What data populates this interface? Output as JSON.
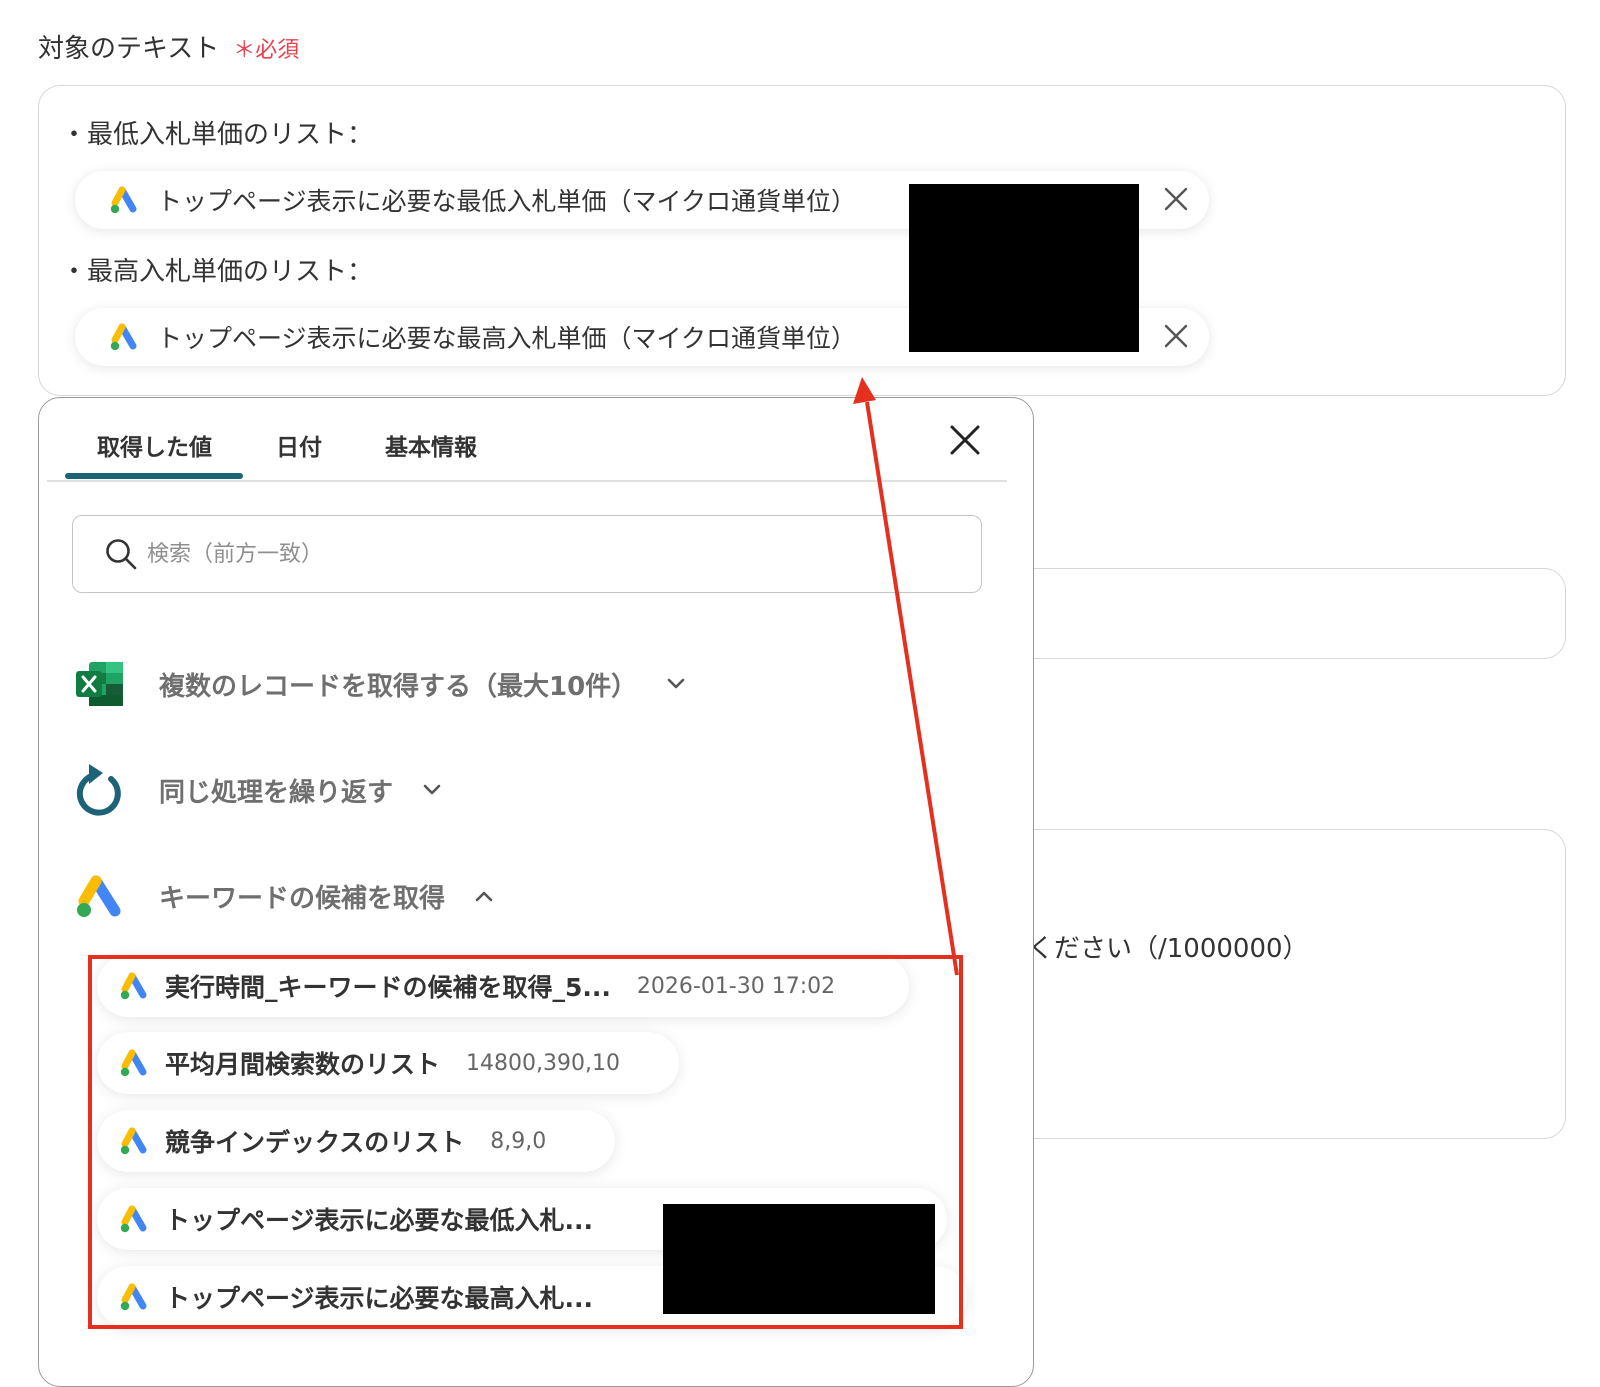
{
  "field": {
    "label": "対象のテキスト",
    "required_mark": "＊",
    "required_text": "必須"
  },
  "text_box": {
    "line1": "・最低入札単価のリスト：",
    "chip1": "トップページ表示に必要な最低入札単価（マイクロ通貨単位）",
    "line2": "・最高入札単価のリスト：",
    "chip2": "トップページ表示に必要な最高入札単価（マイクロ通貨単位）"
  },
  "background": {
    "partial_text": "ください（/1000000）"
  },
  "panel": {
    "tabs": [
      "取得した値",
      "日付",
      "基本情報"
    ],
    "active_tab": 0,
    "search_placeholder": "検索（前方一致）",
    "groups": [
      {
        "label": "複数のレコードを取得する（最大10件）",
        "icon": "excel-icon",
        "expanded": false
      },
      {
        "label": "同じ処理を繰り返す",
        "icon": "loop-icon",
        "expanded": false
      },
      {
        "label": "キーワードの候補を取得",
        "icon": "google-ads-icon",
        "expanded": true
      }
    ],
    "items": [
      {
        "label": "実行時間_キーワードの候補を取得_5...",
        "value": "2026-01-30 17:02"
      },
      {
        "label": "平均月間検索数のリスト",
        "value": "14800,390,10"
      },
      {
        "label": "競争インデックスのリスト",
        "value": "8,9,0"
      },
      {
        "label": "トップページ表示に必要な最低入札...",
        "value": ""
      },
      {
        "label": "トップページ表示に必要な最高入札...",
        "value": ""
      }
    ]
  },
  "colors": {
    "accent": "#1d6378",
    "required": "#e8424f",
    "annotation": "#e5301f",
    "ads_blue": "#4285f4",
    "ads_yellow": "#fbbc04",
    "ads_green": "#34a853"
  }
}
